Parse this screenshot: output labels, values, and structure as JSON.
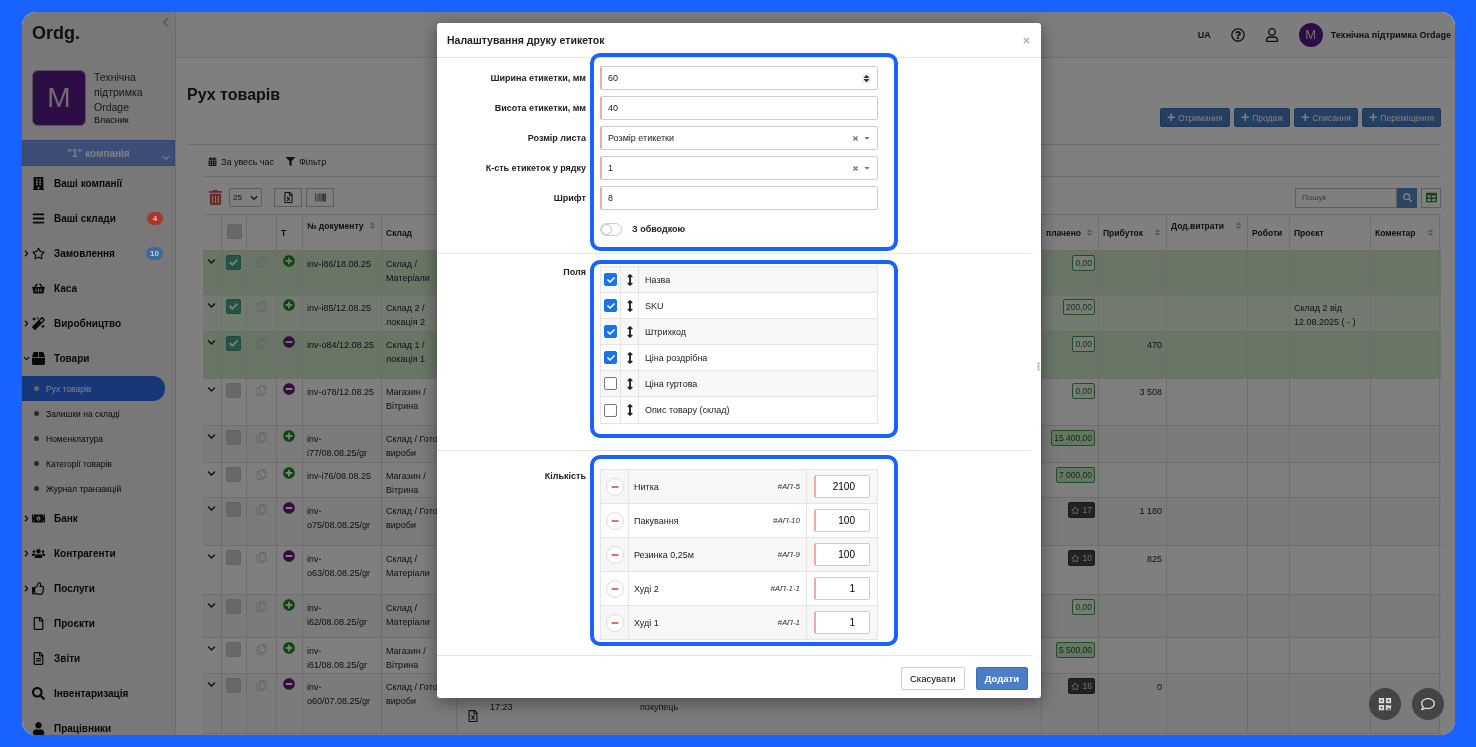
{
  "sidebar": {
    "logo": "Ordg.",
    "avatar_letter": "M",
    "user_name": "Технічна підтримка Ordage",
    "user_role": "Власник",
    "company": "\"1\" компанія",
    "items": [
      {
        "label": "Ваші компанії"
      },
      {
        "label": "Ваші склади",
        "badge": "4",
        "color": "#a8372d"
      },
      {
        "label": "Замовлення",
        "expanded": false,
        "badge": "10",
        "color": "#3a6b9c"
      },
      {
        "label": "Каса"
      },
      {
        "label": "Виробництво",
        "expanded": false
      },
      {
        "label": "Товари",
        "expanded": true,
        "children": [
          {
            "label": "Рух товарів",
            "selected": true
          },
          {
            "label": "Залишки на складі",
            "selected": false
          },
          {
            "label": "Номенклатура",
            "selected": false
          },
          {
            "label": "Категорії товарів",
            "selected": false
          },
          {
            "label": "Журнал транзакцій",
            "selected": false
          }
        ]
      },
      {
        "label": "Банк",
        "expanded": false
      },
      {
        "label": "Контрагенти",
        "expanded": false
      },
      {
        "label": "Послуги",
        "expanded": false
      },
      {
        "label": "Проєкти"
      },
      {
        "label": "Звіти"
      },
      {
        "label": "Інвентаризація"
      },
      {
        "label": "Працівники"
      }
    ]
  },
  "topbar": {
    "language": "UA",
    "avatar_letter": "M",
    "user_name": "Технічна підтримка Ordage"
  },
  "page": {
    "title": "Рух товарів",
    "actions": [
      "Отримання",
      "Продаж",
      "Списання",
      "Переміщення"
    ],
    "period": "За увесь час",
    "filter": "Фільтр",
    "page_size": "25",
    "search": {
      "placeholder": "Пошук"
    }
  },
  "table": {
    "header_checked": false,
    "left_columns": [
      {
        "label": "Т",
        "sortable": false
      },
      {
        "label": "№ документу",
        "sortable": true
      },
      {
        "label": "Склад"
      }
    ],
    "right_columns": [
      {
        "label": "плачено",
        "sortable": true
      },
      {
        "label": "Прибуток",
        "sortable": true
      },
      {
        "label": "Дод.витрати",
        "sortable": true
      },
      {
        "label": "Роботи",
        "sortable": false
      },
      {
        "label": "Проєкт",
        "sortable": false
      },
      {
        "label": "Коментар",
        "sortable": true
      }
    ],
    "rows": [
      {
        "checked": true,
        "kind": "in",
        "doc": "inv-i86/18.08.25",
        "warehouse": [
          "Склад /",
          "Матеріали"
        ],
        "paid": {
          "kind": "outline",
          "text": "0,00"
        }
      },
      {
        "checked": true,
        "kind": "in",
        "doc": "inv-i85/12.08.25",
        "warehouse": [
          "Склад 2 /",
          "локація 2"
        ],
        "paid": {
          "kind": "outline",
          "text": "200,00"
        },
        "project": "Склад 2 від 12.08.2025 ( - )"
      },
      {
        "checked": true,
        "kind": "out",
        "doc": "inv-o84/12.08.25",
        "warehouse": [
          "Склад 1 /",
          "локація 1"
        ],
        "paid": {
          "kind": "outline",
          "text": "0,00"
        },
        "profit": "470"
      },
      {
        "checked": false,
        "kind": "out",
        "doc": "inv-o78/12.08.25",
        "warehouse": [
          "Магазин /",
          "Вітрина"
        ],
        "paid": {
          "kind": "outline",
          "text": "0,00"
        },
        "profit": "3 508"
      },
      {
        "checked": false,
        "kind": "in",
        "doc": "inv-i77/08.08.25/gr",
        "warehouse": [
          "Склад / Гото",
          "вироби"
        ],
        "paid": {
          "kind": "filled",
          "text": "15 400,00"
        }
      },
      {
        "checked": false,
        "kind": "in",
        "doc": "inv-i76/08.08.25",
        "warehouse": [
          "Магазин /",
          "Вітрина"
        ],
        "paid": {
          "kind": "filled",
          "text": "7 000,00"
        }
      },
      {
        "checked": false,
        "kind": "out",
        "doc": "inv-o75/08.08.25/gr",
        "warehouse": [
          "Склад / Гото",
          "вироби"
        ],
        "paid": {
          "kind": "star",
          "text": "17"
        },
        "profit": "1 180"
      },
      {
        "checked": false,
        "kind": "out",
        "doc": "inv-o63/08.08.25/gr",
        "warehouse": [
          "Склад /",
          "Матеріали"
        ],
        "paid": {
          "kind": "star",
          "text": "10"
        },
        "profit": "825"
      },
      {
        "checked": false,
        "kind": "in",
        "doc": "inv-i62/08.08.25/gr",
        "warehouse": [
          "Склад /",
          "Матеріали"
        ],
        "paid": {
          "kind": "outline",
          "text": "0,00"
        }
      },
      {
        "checked": false,
        "kind": "in",
        "doc": "inv-i61/08.08.25/gr",
        "warehouse": [
          "Магазин /",
          "Вітрина"
        ],
        "paid": {
          "kind": "filled",
          "text": "5 500,00"
        }
      },
      {
        "checked": false,
        "kind": "out",
        "doc": "inv-o60/07.08.25/gr",
        "warehouse": [
          "Склад / Гото",
          "вироби"
        ],
        "paid": {
          "kind": "star",
          "text": "16"
        },
        "profit": "0",
        "time": "17:23",
        "counterparty": "покупець"
      }
    ]
  },
  "dialog": {
    "title": "Налаштування друку етикеток",
    "settings": [
      {
        "kind": "number",
        "label": "Ширина етикетки, мм",
        "value": "60"
      },
      {
        "kind": "text",
        "label": "Висота етикетки, мм",
        "value": "40"
      },
      {
        "kind": "select",
        "label": "Розмір листа",
        "value": "Розмір етикетки"
      },
      {
        "kind": "select",
        "label": "К-сть етикеток у рядку",
        "value": "1"
      },
      {
        "kind": "text",
        "label": "Шрифт",
        "value": "8"
      }
    ],
    "border_toggle": {
      "label": "З обводкою",
      "on": false
    },
    "fields_label": "Поля",
    "fields": [
      {
        "label": "Назва",
        "checked": true
      },
      {
        "label": "SKU",
        "checked": true
      },
      {
        "label": "Штрихкод",
        "checked": true
      },
      {
        "label": "Ціна роздрібна",
        "checked": true
      },
      {
        "label": "Ціна гуртова",
        "checked": false
      },
      {
        "label": "Опис товару (склад)",
        "checked": false
      }
    ],
    "quantity_label": "Кількість",
    "items": [
      {
        "name": "Нитка",
        "sku": "#АП-5",
        "quantity": "2100"
      },
      {
        "name": "Пакування",
        "sku": "#АП-10",
        "quantity": "100"
      },
      {
        "name": "Резинка 0,25м",
        "sku": "#АП-9",
        "quantity": "100"
      },
      {
        "name": "Худі 2",
        "sku": "#АП-1-1",
        "quantity": "1"
      },
      {
        "name": "Худі 1",
        "sku": "#АП-1",
        "quantity": "1"
      }
    ],
    "cancel": "Скасувати",
    "confirm": "Додати"
  }
}
